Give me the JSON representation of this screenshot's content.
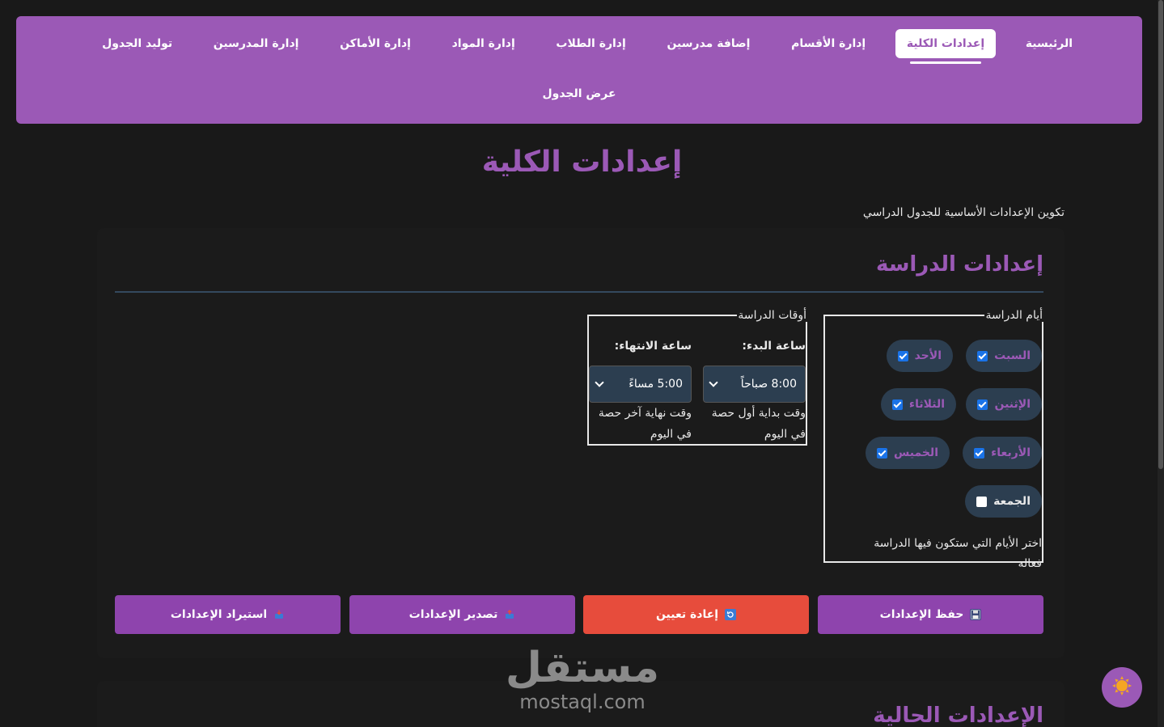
{
  "nav": {
    "items": [
      {
        "label": "الرئيسية",
        "active": false
      },
      {
        "label": "إعدادات الكلية",
        "active": true
      },
      {
        "label": "إدارة الأقسام",
        "active": false
      },
      {
        "label": "إضافة مدرسين",
        "active": false
      },
      {
        "label": "إدارة الطلاب",
        "active": false
      },
      {
        "label": "إدارة المواد",
        "active": false
      },
      {
        "label": "إدارة الأماكن",
        "active": false
      },
      {
        "label": "إدارة المدرسين",
        "active": false
      },
      {
        "label": "توليد الجدول",
        "active": false
      }
    ],
    "second_row": "عرض الجدول"
  },
  "header": {
    "title": "إعدادات الكلية",
    "subtitle": "تكوين الإعدادات الأساسية للجدول الدراسي"
  },
  "study_settings": {
    "title": "إعدادات الدراسة",
    "days": {
      "legend": "أيام الدراسة",
      "items": [
        {
          "label": "السبت",
          "checked": true
        },
        {
          "label": "الأحد",
          "checked": true
        },
        {
          "label": "الإثنين",
          "checked": true
        },
        {
          "label": "الثلاثاء",
          "checked": true
        },
        {
          "label": "الأربعاء",
          "checked": true
        },
        {
          "label": "الخميس",
          "checked": true
        },
        {
          "label": "الجمعة",
          "checked": false
        }
      ],
      "help": "اختر الأيام التي ستكون فيها الدراسة فعالة"
    },
    "times": {
      "legend": "أوقات الدراسة",
      "start_label": "ساعة البدء:",
      "start_value": "8:00 صباحاً",
      "start_help": "وقت بداية أول حصة في اليوم",
      "end_label": "ساعة الانتهاء:",
      "end_value": "5:00 مساءً",
      "end_help": "وقت نهاية آخر حصة في اليوم"
    }
  },
  "actions": {
    "save": "حفظ الإعدادات",
    "reset": "إعادة تعيين",
    "export": "تصدير الإعدادات",
    "import": "استيراد الإعدادات"
  },
  "current_settings": {
    "title": "الإعدادات الحالية"
  },
  "watermark": {
    "arabic": "مستقل",
    "latin": "mostaql.com"
  },
  "colors": {
    "accent": "#9b59b6",
    "button_purple": "#8e44ad",
    "button_red": "#e74c3c",
    "chip_bg": "#2c3e50",
    "background": "#191919"
  }
}
